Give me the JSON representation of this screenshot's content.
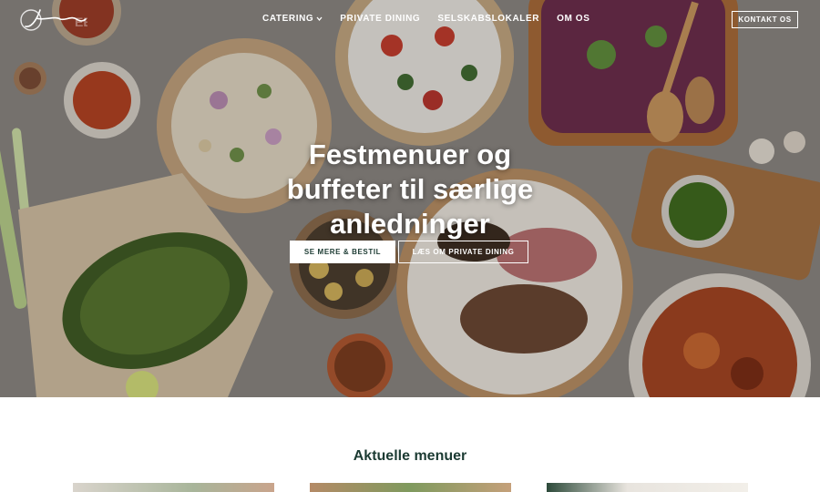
{
  "brand": {
    "logo_text": "Jen"
  },
  "nav": {
    "items": [
      {
        "label": "CATERING",
        "has_dropdown": true
      },
      {
        "label": "PRIVATE DINING",
        "has_dropdown": false
      },
      {
        "label": "SELSKABSLOKALER",
        "has_dropdown": false
      },
      {
        "label": "OM OS",
        "has_dropdown": false
      }
    ],
    "contact_label": "KONTAKT OS"
  },
  "hero": {
    "headline": "Festmenuer og buffeter til særlige anledninger",
    "primary_cta": "SE MERE & BESTIL",
    "secondary_cta": "LÆS OM PRIVATE DINING"
  },
  "section": {
    "title": "Aktuelle menuer"
  },
  "colors": {
    "text": "#1c3b33",
    "white": "#ffffff"
  }
}
